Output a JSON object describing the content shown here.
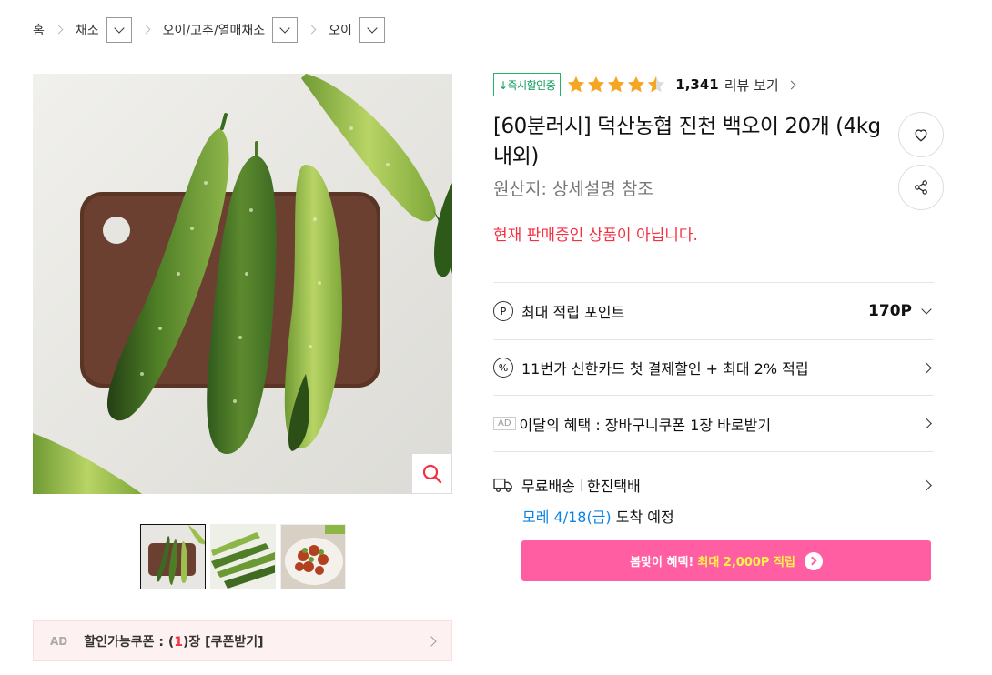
{
  "breadcrumb": {
    "home": "홈",
    "level1": "채소",
    "level2": "오이/고추/열매채소",
    "level3": "오이"
  },
  "product": {
    "badge": "↓즉시할인중",
    "rating": 4.5,
    "review_count": "1,341",
    "review_link": "리뷰 보기",
    "title": "[60분러시] 덕산농협 진천 백오이 20개 (4kg내외)",
    "origin": "원산지:  상세설명 참조",
    "notice": "현재 판매중인 상품이 아닙니다."
  },
  "icons": {
    "wishlist": "heart-icon",
    "share": "share-icon",
    "zoom": "magnifier-icon",
    "points": "point-icon",
    "card": "percent-icon",
    "delivery": "truck-icon"
  },
  "benefits": {
    "points_label": "최대 적립 포인트",
    "points_value": "170P",
    "card_label": "11번가 신한카드 첫 결제할인 + 최대 2% 적립",
    "ad_label": "AD",
    "monthly_label": "이달의 혜택 : 장바구니쿠폰 1장 바로받기"
  },
  "shipping": {
    "method": "무료배송",
    "carrier": "한진택배",
    "eta_date": "모레 4/18(금)",
    "eta_suffix": " 도착 예정"
  },
  "promo": {
    "prefix": "봄맞이 혜택!",
    "highlight": "최대 2,000P 적립"
  },
  "coupon": {
    "ad": "AD",
    "text_prefix": "할인가능쿠폰 : (",
    "count": "1",
    "text_suffix": ")장 [쿠폰받기]"
  },
  "colors": {
    "accent_red": "#f43142",
    "promo_pink": "#ff5fa2",
    "badge_green": "#0a9a55",
    "star": "#f5a623",
    "eta_blue": "#0b83e6"
  }
}
